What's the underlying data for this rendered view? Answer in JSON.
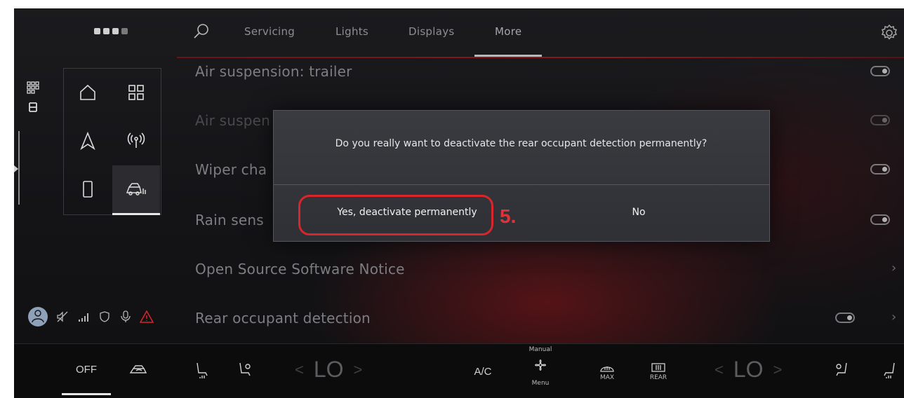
{
  "tabs": [
    {
      "label": "Servicing"
    },
    {
      "label": "Lights"
    },
    {
      "label": "Displays"
    },
    {
      "label": "More"
    }
  ],
  "list": [
    {
      "label": "Air suspension: trailer"
    },
    {
      "label": "Air suspen"
    },
    {
      "label": "Wiper cha"
    },
    {
      "label": "Rain sens"
    },
    {
      "label": "Open Source Software Notice"
    },
    {
      "label": "Rear occupant detection"
    }
  ],
  "modal": {
    "message": "Do you really want to deactivate the rear occupant detection permanently?",
    "yes_label": "Yes, deactivate permanently",
    "no_label": "No"
  },
  "annotation": {
    "step": "5."
  },
  "climate": {
    "off_label": "OFF",
    "left_temp": "LO",
    "right_temp": "LO",
    "ac_label": "A/C",
    "fan_mode_label": "Manual",
    "fan_menu_label": "Menu",
    "max_label": "MAX",
    "rear_label": "REAR"
  },
  "icons": [
    "search-icon",
    "gear-icon",
    "home-icon",
    "apps-icon",
    "navigation-icon",
    "radio-icon",
    "phone-icon",
    "car-icon",
    "seat-heat-icon",
    "fan-icon",
    "defrost-icon",
    "warning-icon"
  ],
  "colors": {
    "accent_red": "#d8262c",
    "background": "#141416"
  }
}
